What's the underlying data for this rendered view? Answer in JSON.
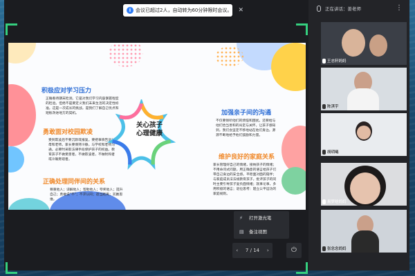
{
  "notice": {
    "text": "会议已超过2人，自动转为60分钟限时会议。"
  },
  "slide": {
    "center_text_line1": "关心孩子",
    "center_text_line2": "心理健康",
    "sections": [
      {
        "title": "积极应对学习压力",
        "body": "正确看待期末检测。它是对我们学习内容掌握程度的检验。但绝不是要定义我们未来生活的决定性标准。这是一次成长的挑战。是我们了解自己优点和短板改进地方的契机。"
      },
      {
        "title": "勇敢面对校园欺凌",
        "body": "受到欺凌后不要沉默或报复。要把事情告诉父母和老师。家长要保持冷静，与学校和老师沟通。必要时采取法律手段保护孩子的权益。教育孩子不做受害者，不做欺凌者，不做附和者或冷眼旁观者。"
      },
      {
        "title": "正确处理同伴间的关系",
        "body": "尊重他人；谅解他人；帮助他人；夸奖他人；提升自己；勇敢说\"不\"；不求认同；适当距离；双赢思维。"
      },
      {
        "title": "加强亲子间的沟通",
        "body": "不仅要倾听他们的烦恼和困扰。还要给与他们恰当善和的肯定与关怀。让孩子感知到，我们会坚定不移地站在他们身边。源源不断地给予他们鼓励和力量。"
      },
      {
        "title": "维护良好的家庭关系",
        "body": "家长管理好自己的情绪，接纳孩子的情绪；不用命问式问题，用正确意的语言给孩子们带自己身边的安全感。平稳面对面的陪伴；与家庭成员法法规教育孩子。批评孩子的同时主要引导孩子复负面情绪；就事论事，多用积极的语言；退位思考：建立公平运功的家庭规则。"
      }
    ]
  },
  "menu": {
    "laser_label": "打开激光笔",
    "note_label": "备注视图"
  },
  "pager": {
    "current": "7",
    "total": "14",
    "separator": "/"
  },
  "panel": {
    "speaking_label": "正在讲话：",
    "speaker": "姜老师"
  },
  "participants": [
    {
      "name": "王志轩妈妈"
    },
    {
      "name": "陈淇宇"
    },
    {
      "name": "胡玥曦"
    },
    {
      "name": "易梦晗妈妈"
    },
    {
      "name": "张念念妈妈"
    }
  ],
  "colors": {
    "accent_green": "#35d07f",
    "title_blue": "#2f6fd6",
    "title_orange": "#f08a2c"
  }
}
